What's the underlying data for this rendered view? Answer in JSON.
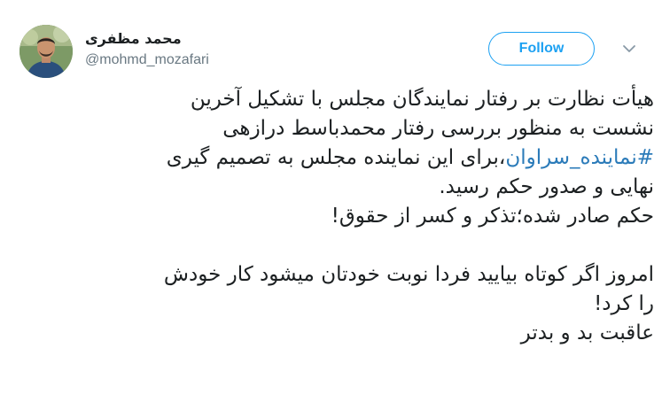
{
  "tweet": {
    "author": {
      "display_name": "محمد مظفری",
      "screen_name": "@mohmd_mozafari",
      "avatar_icon": "avatar-photo"
    },
    "follow_label": "Follow",
    "more_icon": "chevron-down-icon",
    "body": {
      "line1": "هیأت نظارت بر رفتار نمایندگان مجلس با تشکیل آخرین",
      "line2": "نشست به منظور بررسی رفتار محمدباسط درازهی",
      "hashtag": "#نماینده_سراوان",
      "line3_rest": "،برای این نماینده مجلس به تصمیم گیری",
      "line4": "نهایی و صدور حکم رسید.",
      "line5": "حکم صادر شده؛تذکر و کسر از حقوق!",
      "line6": "امروز اگر کوتاه بیایید فردا نوبت خودتان میشود کار خودش",
      "line7": "را کرد!",
      "line8": "عاقبت بد و بدتر"
    }
  },
  "colors": {
    "accent": "#1da1f2",
    "hashtag": "#2b7bb9",
    "text": "#1c2022",
    "muted": "#697882"
  }
}
